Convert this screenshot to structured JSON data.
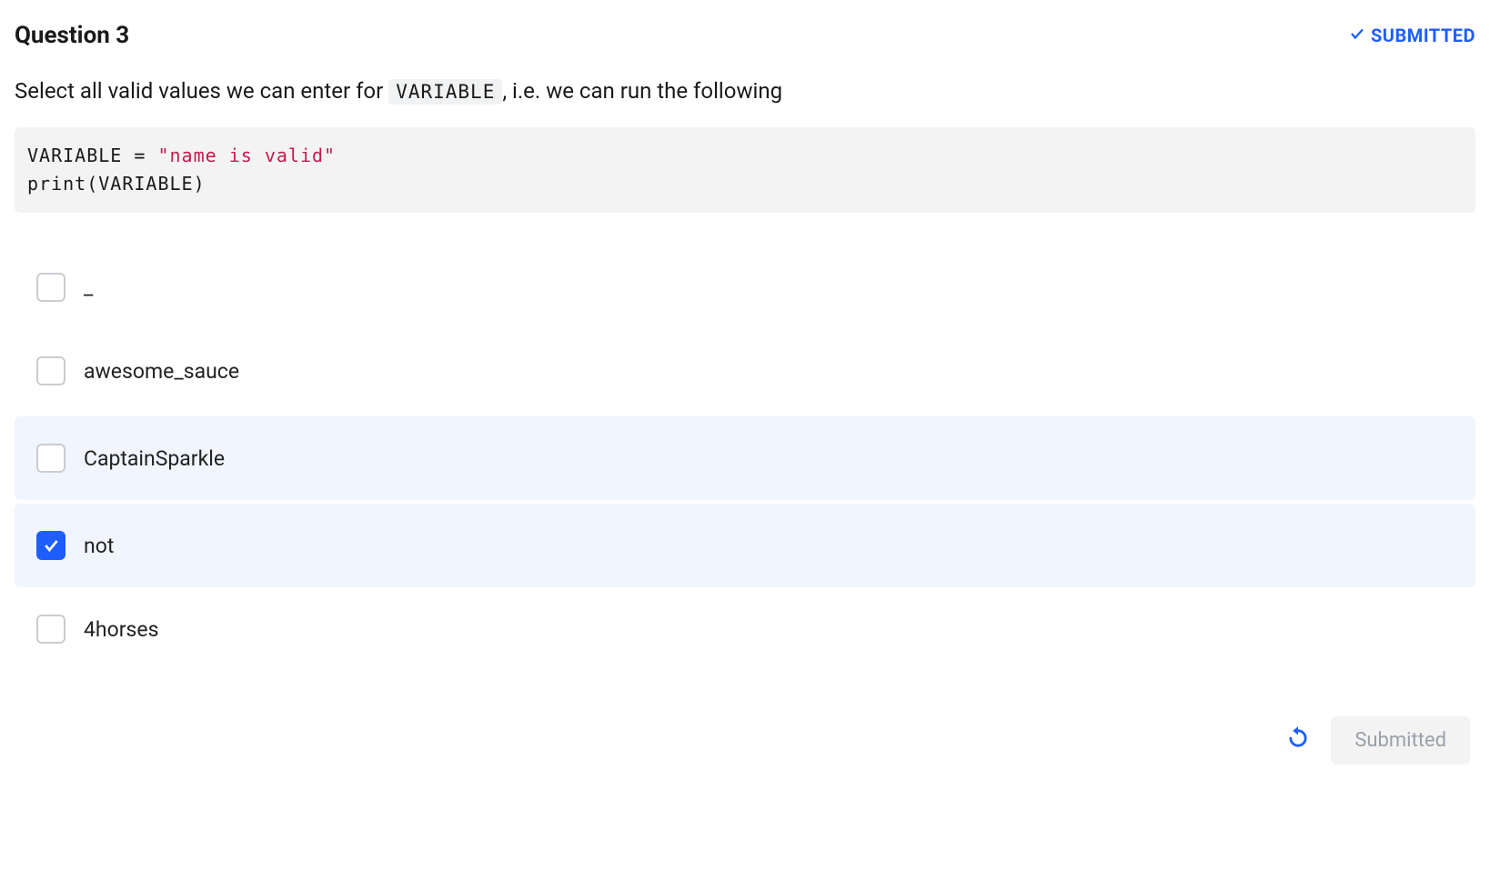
{
  "header": {
    "title": "Question 3",
    "status_label": "SUBMITTED"
  },
  "prompt": {
    "before_code": "Select all valid values we can enter for ",
    "code_token": "VARIABLE",
    "after_code": ", i.e. we can run the following"
  },
  "code": {
    "line1_lhs": "VARIABLE = ",
    "line1_str": "\"name is valid\"",
    "line2": "print(VARIABLE)"
  },
  "options": [
    {
      "label": "_",
      "checked": false,
      "highlight": false
    },
    {
      "label": "awesome_sauce",
      "checked": false,
      "highlight": false
    },
    {
      "label": "CaptainSparkle",
      "checked": false,
      "highlight": true
    },
    {
      "label": "not",
      "checked": true,
      "highlight": true
    },
    {
      "label": "4horses",
      "checked": false,
      "highlight": false
    }
  ],
  "footer": {
    "button_label": "Submitted"
  }
}
